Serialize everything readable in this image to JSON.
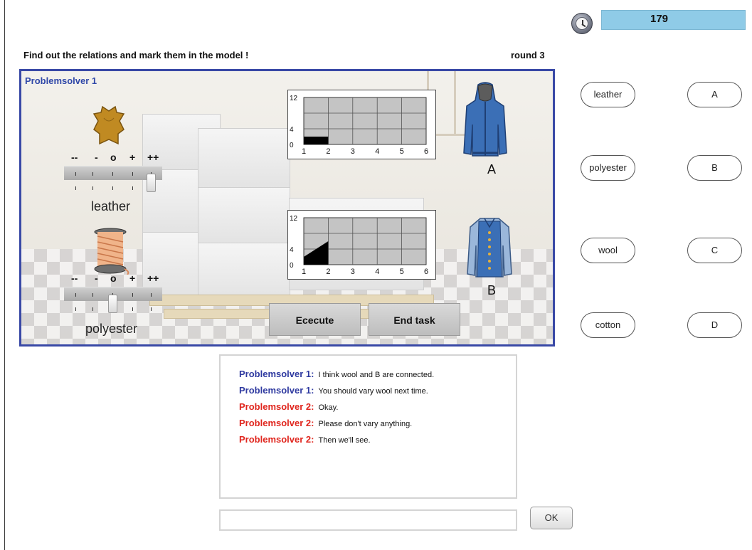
{
  "timer": {
    "value": "179",
    "icon": "clock-icon"
  },
  "instruction": "Find out the relations and mark them in the model !",
  "round": "round 3",
  "scene": {
    "title": "Problemsolver 1",
    "scale_labels": [
      "--",
      "-",
      "o",
      "+",
      "++"
    ],
    "sliders": [
      {
        "label": "leather",
        "icon": "leather-hide-icon",
        "level": "++"
      },
      {
        "label": "polyester",
        "icon": "thread-spool-icon",
        "level": "o"
      }
    ],
    "plots": [
      {
        "garment": "A",
        "icon": "hoodie-icon",
        "y_ticks": [
          "12",
          "4",
          "0"
        ],
        "x_ticks": [
          "1",
          "2",
          "3",
          "4",
          "5",
          "6"
        ],
        "ylim": [
          0,
          12
        ],
        "xlim": [
          1,
          6
        ],
        "series": [
          [
            1,
            2
          ],
          [
            2,
            2
          ]
        ]
      },
      {
        "garment": "B",
        "icon": "vest-jacket-icon",
        "y_ticks": [
          "12",
          "4",
          "0"
        ],
        "x_ticks": [
          "1",
          "2",
          "3",
          "4",
          "5",
          "6"
        ],
        "ylim": [
          0,
          12
        ],
        "xlim": [
          1,
          6
        ],
        "series": [
          [
            1,
            2
          ],
          [
            2,
            6
          ]
        ]
      }
    ],
    "buttons": {
      "execute": "Ececute",
      "end_task": "End task"
    }
  },
  "variables": [
    "leather",
    "polyester",
    "wool",
    "cotton"
  ],
  "outcomes": [
    "A",
    "B",
    "C",
    "D"
  ],
  "chat": {
    "messages": [
      {
        "speaker": "Problemsolver 1:",
        "text": "I think wool and B are connected.",
        "color": "#2f3aa0"
      },
      {
        "speaker": "Problemsolver 1:",
        "text": "You should vary wool next time.",
        "color": "#2f3aa0"
      },
      {
        "speaker": "Problemsolver 2:",
        "text": "Okay.",
        "color": "#e0261e"
      },
      {
        "speaker": "Problemsolver 2:",
        "text": "Please don't vary anything.",
        "color": "#e0261e"
      },
      {
        "speaker": "Problemsolver 2:",
        "text": "Then we'll see.",
        "color": "#e0261e"
      }
    ],
    "input_value": "",
    "ok_label": "OK"
  },
  "colors": {
    "frame": "#3949a6",
    "timer_bar": "#8fcbe7",
    "ps1": "#2f3aa0",
    "ps2": "#e0261e",
    "jacket": "#3b6fb6"
  }
}
